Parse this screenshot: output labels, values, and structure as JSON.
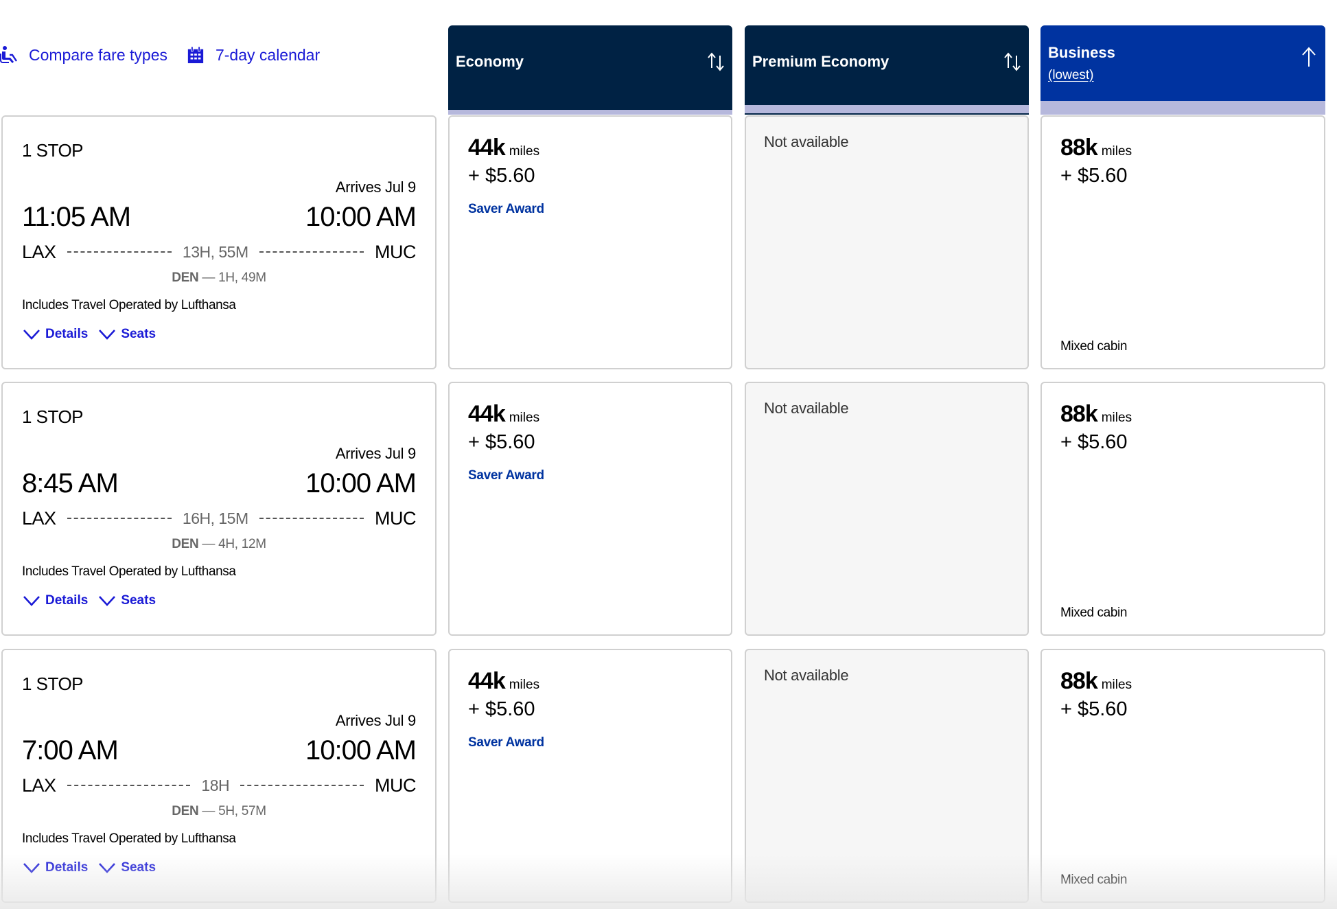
{
  "top_links": {
    "compare": {
      "label": "Compare fare types",
      "icon": "seat-icon"
    },
    "calendar": {
      "label": "7-day calendar",
      "icon": "calendar-icon"
    }
  },
  "colors": {
    "link": "#1a1ad6",
    "header_dark": "#002244",
    "header_selected": "#0033a0",
    "header_band": "#b6b8dc",
    "saver_award": "#0033a0"
  },
  "columns": [
    {
      "title": "Economy",
      "subtitle": "",
      "sort_icon": "sort-both-icon"
    },
    {
      "title": "Premium Economy",
      "subtitle": "",
      "sort_icon": "sort-both-icon"
    },
    {
      "title": "Business",
      "subtitle": "(lowest)",
      "sort_icon": "sort-up-icon"
    }
  ],
  "flights": [
    {
      "stops": "1 STOP",
      "arrives": "Arrives Jul 9",
      "depart_time": "11:05 AM",
      "arrive_time": "10:00 AM",
      "origin": "LAX",
      "destination": "MUC",
      "duration": "13H, 55M",
      "layover_code": "DEN",
      "layover_time": "— 1H, 49M",
      "operated": "Includes Travel Operated by Lufthansa",
      "details_label": "Details",
      "seats_label": "Seats",
      "fares": {
        "economy": {
          "miles": "44k",
          "unit": "miles",
          "tax": "+ $5.60",
          "type": "Saver Award"
        },
        "premium": {
          "status": "Not available"
        },
        "business": {
          "miles": "88k",
          "unit": "miles",
          "tax": "+ $5.60",
          "note": "Mixed cabin"
        }
      }
    },
    {
      "stops": "1 STOP",
      "arrives": "Arrives Jul 9",
      "depart_time": "8:45 AM",
      "arrive_time": "10:00 AM",
      "origin": "LAX",
      "destination": "MUC",
      "duration": "16H, 15M",
      "layover_code": "DEN",
      "layover_time": "— 4H, 12M",
      "operated": "Includes Travel Operated by Lufthansa",
      "details_label": "Details",
      "seats_label": "Seats",
      "fares": {
        "economy": {
          "miles": "44k",
          "unit": "miles",
          "tax": "+ $5.60",
          "type": "Saver Award"
        },
        "premium": {
          "status": "Not available"
        },
        "business": {
          "miles": "88k",
          "unit": "miles",
          "tax": "+ $5.60",
          "note": "Mixed cabin"
        }
      }
    },
    {
      "stops": "1 STOP",
      "arrives": "Arrives Jul 9",
      "depart_time": "7:00 AM",
      "arrive_time": "10:00 AM",
      "origin": "LAX",
      "destination": "MUC",
      "duration": "18H",
      "layover_code": "DEN",
      "layover_time": "— 5H, 57M",
      "operated": "Includes Travel Operated by Lufthansa",
      "details_label": "Details",
      "seats_label": "Seats",
      "fares": {
        "economy": {
          "miles": "44k",
          "unit": "miles",
          "tax": "+ $5.60",
          "type": "Saver Award"
        },
        "premium": {
          "status": "Not available"
        },
        "business": {
          "miles": "88k",
          "unit": "miles",
          "tax": "+ $5.60",
          "note": "Mixed cabin"
        }
      }
    }
  ]
}
